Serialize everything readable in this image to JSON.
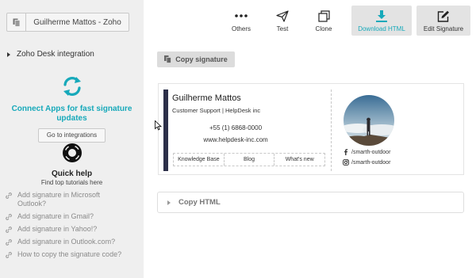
{
  "sidebar": {
    "signature_name": "Guilherme Mattos - Zoho",
    "integration_label": "Zoho Desk integration",
    "connect_title": "Connect Apps for fast signature updates",
    "integrations_button": "Go to integrations",
    "help_title": "Quick help",
    "help_subtitle": "Find top tutorials here",
    "help_links": [
      "Add signature in Microsoft Outlook?",
      "Add signature in Gmail?",
      "Add signature in Yahoo!?",
      "Add signature in Outlook.com?",
      "How to copy the signature code?"
    ]
  },
  "toolbar": {
    "others": "Others",
    "test": "Test",
    "clone": "Clone",
    "download": "Download HTML",
    "edit": "Edit Signature"
  },
  "main": {
    "copy_signature": "Copy signature",
    "copy_html": "Copy HTML"
  },
  "signature": {
    "name": "Guilherme Mattos",
    "role": "Customer Support | HelpDesk inc",
    "phone": "+55 (1) 6868-0000",
    "website": "www.helpdesk-inc.com",
    "links": [
      "Knowledge Base",
      "Blog",
      "What's new"
    ],
    "facebook": "/smarth-outdoor",
    "instagram": "/smarth-outdoor"
  },
  "colors": {
    "accent": "#17a9ba",
    "signature_bar": "#2c2f49",
    "sidebar_bg": "#efefef"
  }
}
